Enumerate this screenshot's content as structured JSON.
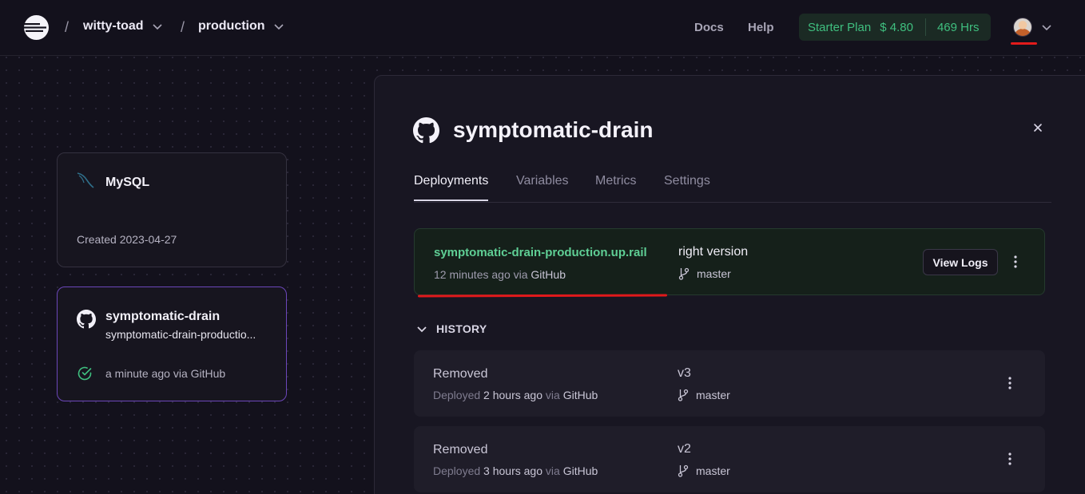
{
  "header": {
    "project": "witty-toad",
    "environment": "production",
    "separator": "/",
    "nav": [
      "Docs",
      "Help"
    ],
    "plan": {
      "name": "Starter Plan",
      "cost": "$ 4.80",
      "hours": "469 Hrs"
    }
  },
  "canvas": {
    "cards": [
      {
        "title": "MySQL",
        "subtitle": "Created 2023-04-27",
        "icon": "mysql-dolphin-icon"
      },
      {
        "title": "symptomatic-drain",
        "domain": "symptomatic-drain-productio...",
        "status": "a minute ago via GitHub",
        "icon": "github-icon",
        "status_icon": "check-circle-icon"
      }
    ]
  },
  "panel": {
    "title": "symptomatic-drain",
    "tabs": [
      "Deployments",
      "Variables",
      "Metrics",
      "Settings"
    ],
    "active_deployment": {
      "url": "symptomatic-drain-production.up.rail",
      "time": "12 minutes ago",
      "via": "via",
      "source": "GitHub",
      "message": "right version",
      "branch": "master",
      "view_logs": "View Logs"
    },
    "history_label": "HISTORY",
    "history": [
      {
        "status": "Removed",
        "deployed": "Deployed",
        "time": "2 hours ago",
        "via": "via",
        "source": "GitHub",
        "version": "v3",
        "branch": "master"
      },
      {
        "status": "Removed",
        "deployed": "Deployed",
        "time": "3 hours ago",
        "via": "via",
        "source": "GitHub",
        "version": "v2",
        "branch": "master"
      }
    ]
  },
  "colors": {
    "background": "#13111c",
    "accent_green": "#3fbf7f",
    "selected_border": "#6c47ba",
    "annotation_red": "#e0191b"
  }
}
